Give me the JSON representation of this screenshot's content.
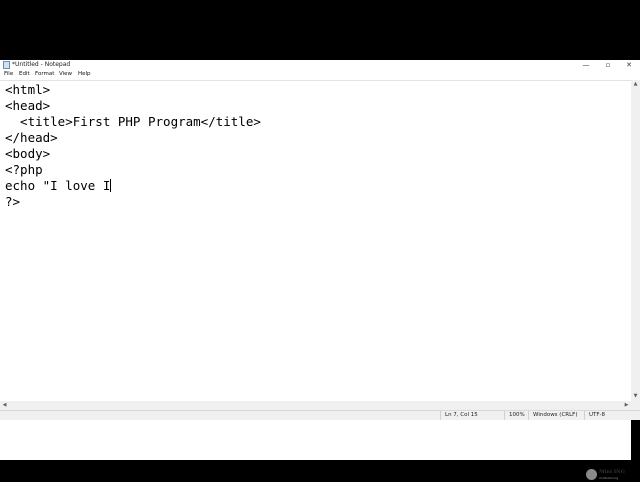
{
  "window": {
    "title": "*Untitled - Notepad",
    "controls": {
      "minimize": "—",
      "maximize": "▫",
      "close": "✕"
    }
  },
  "menu": {
    "items": [
      "File",
      "Edit",
      "Format",
      "View",
      "Help"
    ]
  },
  "editor": {
    "lines": [
      "<html>",
      "<head>",
      "  <title>First PHP Program</title>",
      "</head>",
      "<body>",
      "<?php",
      "echo \"I love I",
      "?>"
    ]
  },
  "status": {
    "position": "Ln 7, Col 15",
    "zoom": "100%",
    "line_endings": "Windows (CRLF)",
    "encoding": "UTF-8"
  },
  "watermark": {
    "text": "Mini ING",
    "subtext": "minitutor.ing"
  },
  "icons": {
    "app": "notepad-icon",
    "scroll_up": "chevron-up-icon",
    "scroll_down": "chevron-down-icon",
    "scroll_left": "chevron-left-icon",
    "scroll_right": "chevron-right-icon"
  },
  "colors": {
    "letterbox": "#000000",
    "editor_bg": "#ffffff",
    "chrome_bg": "#f0f0f0"
  }
}
